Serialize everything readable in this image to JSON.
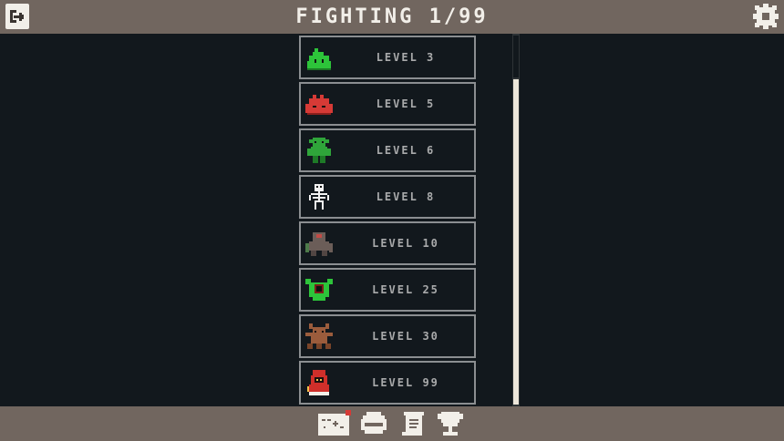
{
  "header": {
    "title": "FIGHTING 1/99"
  },
  "levels": [
    {
      "label": "LEVEL 3",
      "monster": "green-slime-icon"
    },
    {
      "label": "LEVEL 5",
      "monster": "red-slime-icon"
    },
    {
      "label": "LEVEL 6",
      "monster": "goblin-icon"
    },
    {
      "label": "LEVEL 8",
      "monster": "skeleton-icon"
    },
    {
      "label": "LEVEL 10",
      "monster": "golem-icon"
    },
    {
      "label": "LEVEL 25",
      "monster": "eyeball-plant-icon"
    },
    {
      "label": "LEVEL 30",
      "monster": "treant-icon"
    },
    {
      "label": "LEVEL 99",
      "monster": "red-mage-icon"
    }
  ],
  "bottom_nav": [
    "map-icon",
    "helmet-icon",
    "scroll-icon",
    "trophy-icon"
  ],
  "colors": {
    "bar": "#71665f",
    "background": "#12181d",
    "row_border": "#8b8e91",
    "text": "#a9aaab"
  }
}
